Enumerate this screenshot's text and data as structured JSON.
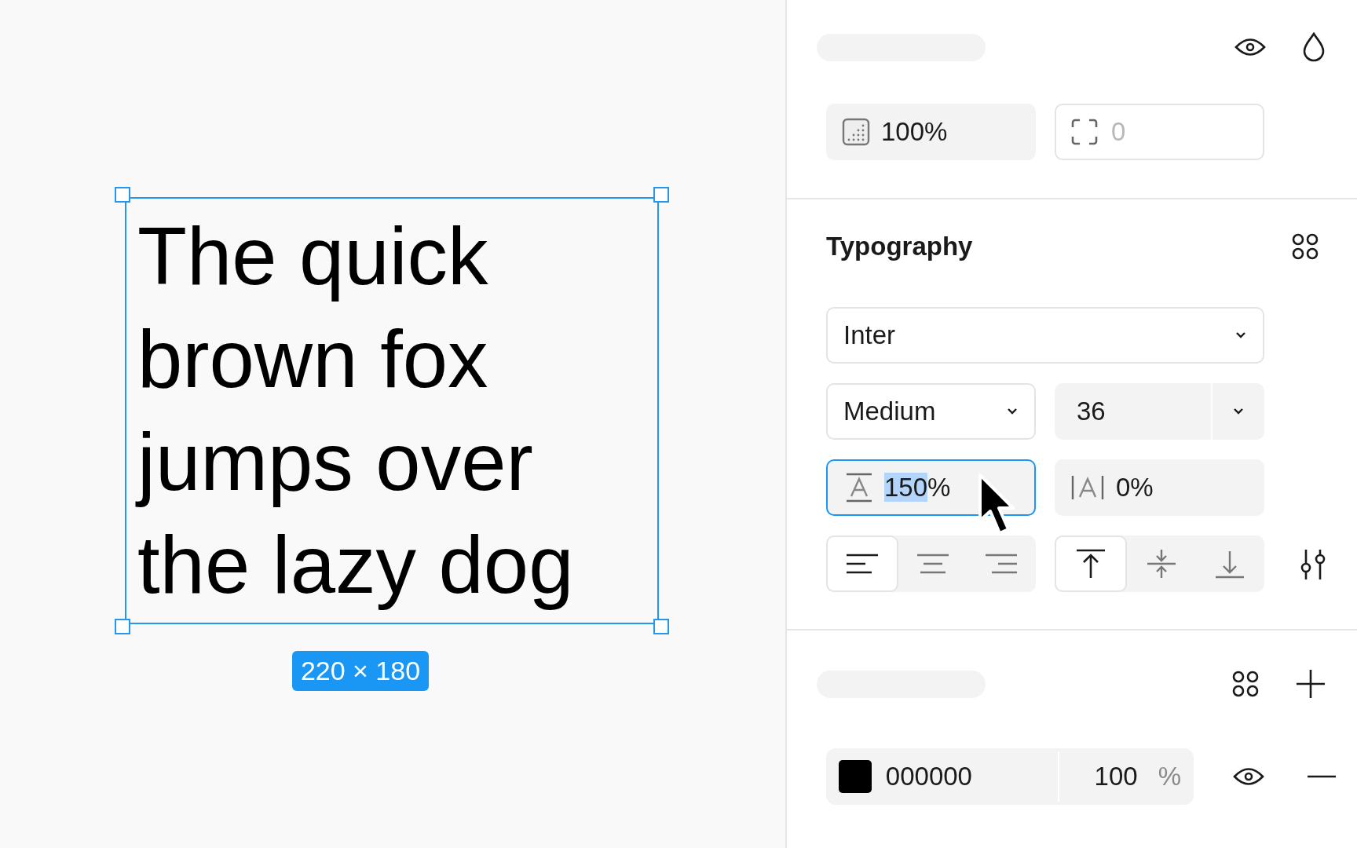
{
  "canvas": {
    "text_layer": {
      "lines": [
        "The quick",
        "brown fox",
        "jumps over",
        "the lazy dog"
      ],
      "selected": true
    },
    "size_label": "220 × 180"
  },
  "layer": {
    "opacity": "100%",
    "corner_radius": {
      "placeholder": "0"
    }
  },
  "typography": {
    "title": "Typography",
    "font_family": "Inter",
    "font_weight": "Medium",
    "font_size": "36",
    "line_height": {
      "value": "150",
      "unit": "%",
      "focused": true,
      "value_highlighted": true
    },
    "letter_spacing": "0%",
    "horizontal_align": [
      {
        "kind": "left",
        "selected": true
      },
      {
        "kind": "center",
        "selected": false
      },
      {
        "kind": "right",
        "selected": false
      }
    ],
    "vertical_align": [
      {
        "kind": "top",
        "selected": true
      },
      {
        "kind": "middle",
        "selected": false
      },
      {
        "kind": "bottom",
        "selected": false
      }
    ]
  },
  "fill": {
    "color": "#000000",
    "hex": "000000",
    "opacity": "100",
    "unit": "%"
  }
}
